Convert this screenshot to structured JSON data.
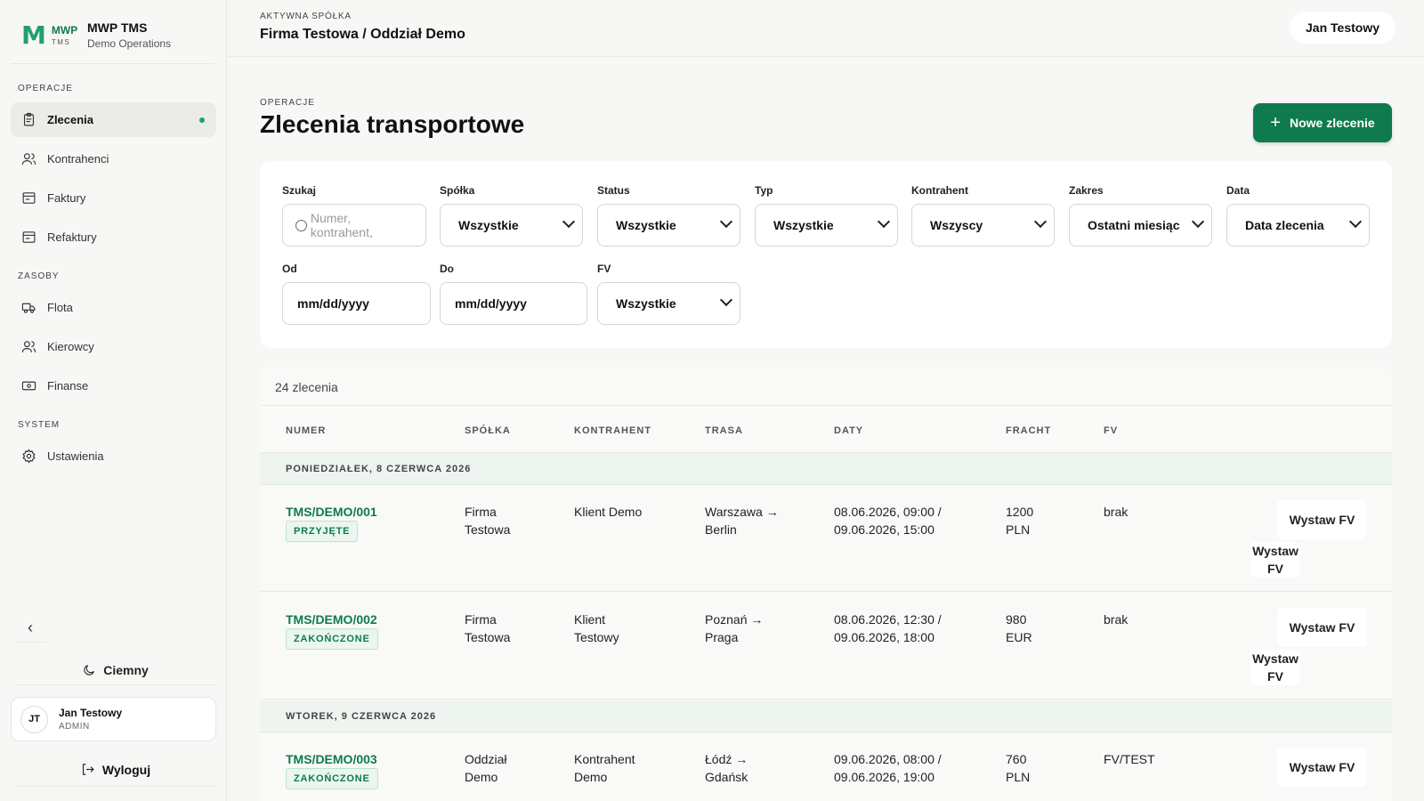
{
  "brand": {
    "mark": "M",
    "mwp": "MWP",
    "tms": "TMS",
    "title": "MWP TMS",
    "subtitle": "Demo Operations"
  },
  "sidebar": {
    "sections": [
      "OPERACJE",
      "ZASOBY",
      "SYSTEM"
    ],
    "items": [
      {
        "label": "Zlecenia",
        "icon": "clipboard-icon",
        "active": true
      },
      {
        "label": "Kontrahenci",
        "icon": "users-icon"
      },
      {
        "label": "Faktury",
        "icon": "invoice-icon"
      },
      {
        "label": "Refaktury",
        "icon": "invoice-icon"
      },
      {
        "label": "Flota",
        "icon": "truck-icon"
      },
      {
        "label": "Kierowcy",
        "icon": "users-icon"
      },
      {
        "label": "Finanse",
        "icon": "banknote-icon"
      },
      {
        "label": "Ustawienia",
        "icon": "gear-icon"
      }
    ],
    "collapse": "‹",
    "theme_label": "Ciemny",
    "user": {
      "initials": "JT",
      "name": "Jan Testowy",
      "role": "ADMIN"
    },
    "logout_label": "Wyloguj"
  },
  "header": {
    "company_label": "AKTYWNA SPÓŁKA",
    "company_value": "Firma Testowa / Oddział Demo",
    "user": "Jan Testowy"
  },
  "page": {
    "eyebrow": "OPERACJE",
    "title": "Zlecenia transportowe",
    "new_button": "Nowe zlecenie",
    "new_plus": "+"
  },
  "filters": {
    "search": {
      "label": "Szukaj",
      "placeholder": "Numer, kontrahent,"
    },
    "company": {
      "label": "Spółka",
      "value": "Wszystkie"
    },
    "status": {
      "label": "Status",
      "value": "Wszystkie"
    },
    "type": {
      "label": "Typ",
      "value": "Wszystkie"
    },
    "contractor": {
      "label": "Kontrahent",
      "value": "Wszyscy"
    },
    "range": {
      "label": "Zakres",
      "value": "Ostatni miesiąc"
    },
    "date": {
      "label": "Data",
      "value": "Data zlecenia"
    },
    "from": {
      "label": "Od",
      "value": "mm/dd/yyyy"
    },
    "to": {
      "label": "Do",
      "value": "mm/dd/yyyy"
    },
    "fv": {
      "label": "FV",
      "value": "Wszystkie"
    }
  },
  "table": {
    "count": "24 zlecenia",
    "headers": [
      "NUMER",
      "SPÓŁKA",
      "KONTRAHENT",
      "TRASA",
      "DATY",
      "FRACHT",
      "FV"
    ],
    "groups": [
      "PONIEDZIAŁEK, 8 CZERWCA 2026",
      "WTOREK, 9 CZERWCA 2026"
    ],
    "rows": [
      {
        "number": "TMS/DEMO/001",
        "status": "PRZYJĘTE",
        "company": [
          "Firma",
          "Testowa"
        ],
        "contractor": [
          "Klient Demo",
          ""
        ],
        "route": [
          "Warszawa →",
          "Berlin"
        ],
        "dates": [
          "08.06.2026, 09:00 /",
          "09.06.2026, 15:00"
        ],
        "freight": [
          "1200",
          "PLN"
        ],
        "fv": "brak",
        "action": "Wystaw FV",
        "action2": [
          "Wystaw",
          "FV"
        ]
      },
      {
        "number": "TMS/DEMO/002",
        "status": "ZAKOŃCZONE",
        "company": [
          "Firma",
          "Testowa"
        ],
        "contractor": [
          "Klient",
          "Testowy"
        ],
        "route": [
          "Poznań →",
          "Praga"
        ],
        "dates": [
          "08.06.2026, 12:30 /",
          "09.06.2026, 18:00"
        ],
        "freight": [
          "980",
          "EUR"
        ],
        "fv": "brak",
        "action": "Wystaw FV",
        "action2": [
          "Wystaw",
          "FV"
        ]
      },
      {
        "number": "TMS/DEMO/003",
        "status": "ZAKOŃCZONE",
        "company": [
          "Oddział",
          "Demo"
        ],
        "contractor": [
          "Kontrahent",
          "Demo"
        ],
        "route": [
          "Łódź →",
          "Gdańsk"
        ],
        "dates": [
          "09.06.2026, 08:00 /",
          "09.06.2026, 19:00"
        ],
        "freight": [
          "760",
          "PLN"
        ],
        "fv": "FV/TEST",
        "action": "Wystaw FV"
      }
    ]
  },
  "colors": {
    "accent": "#0f7a4e",
    "brand_mark": "#22a06b",
    "active_dot": "#1fa36d",
    "group_bg": "#eef4ef"
  }
}
